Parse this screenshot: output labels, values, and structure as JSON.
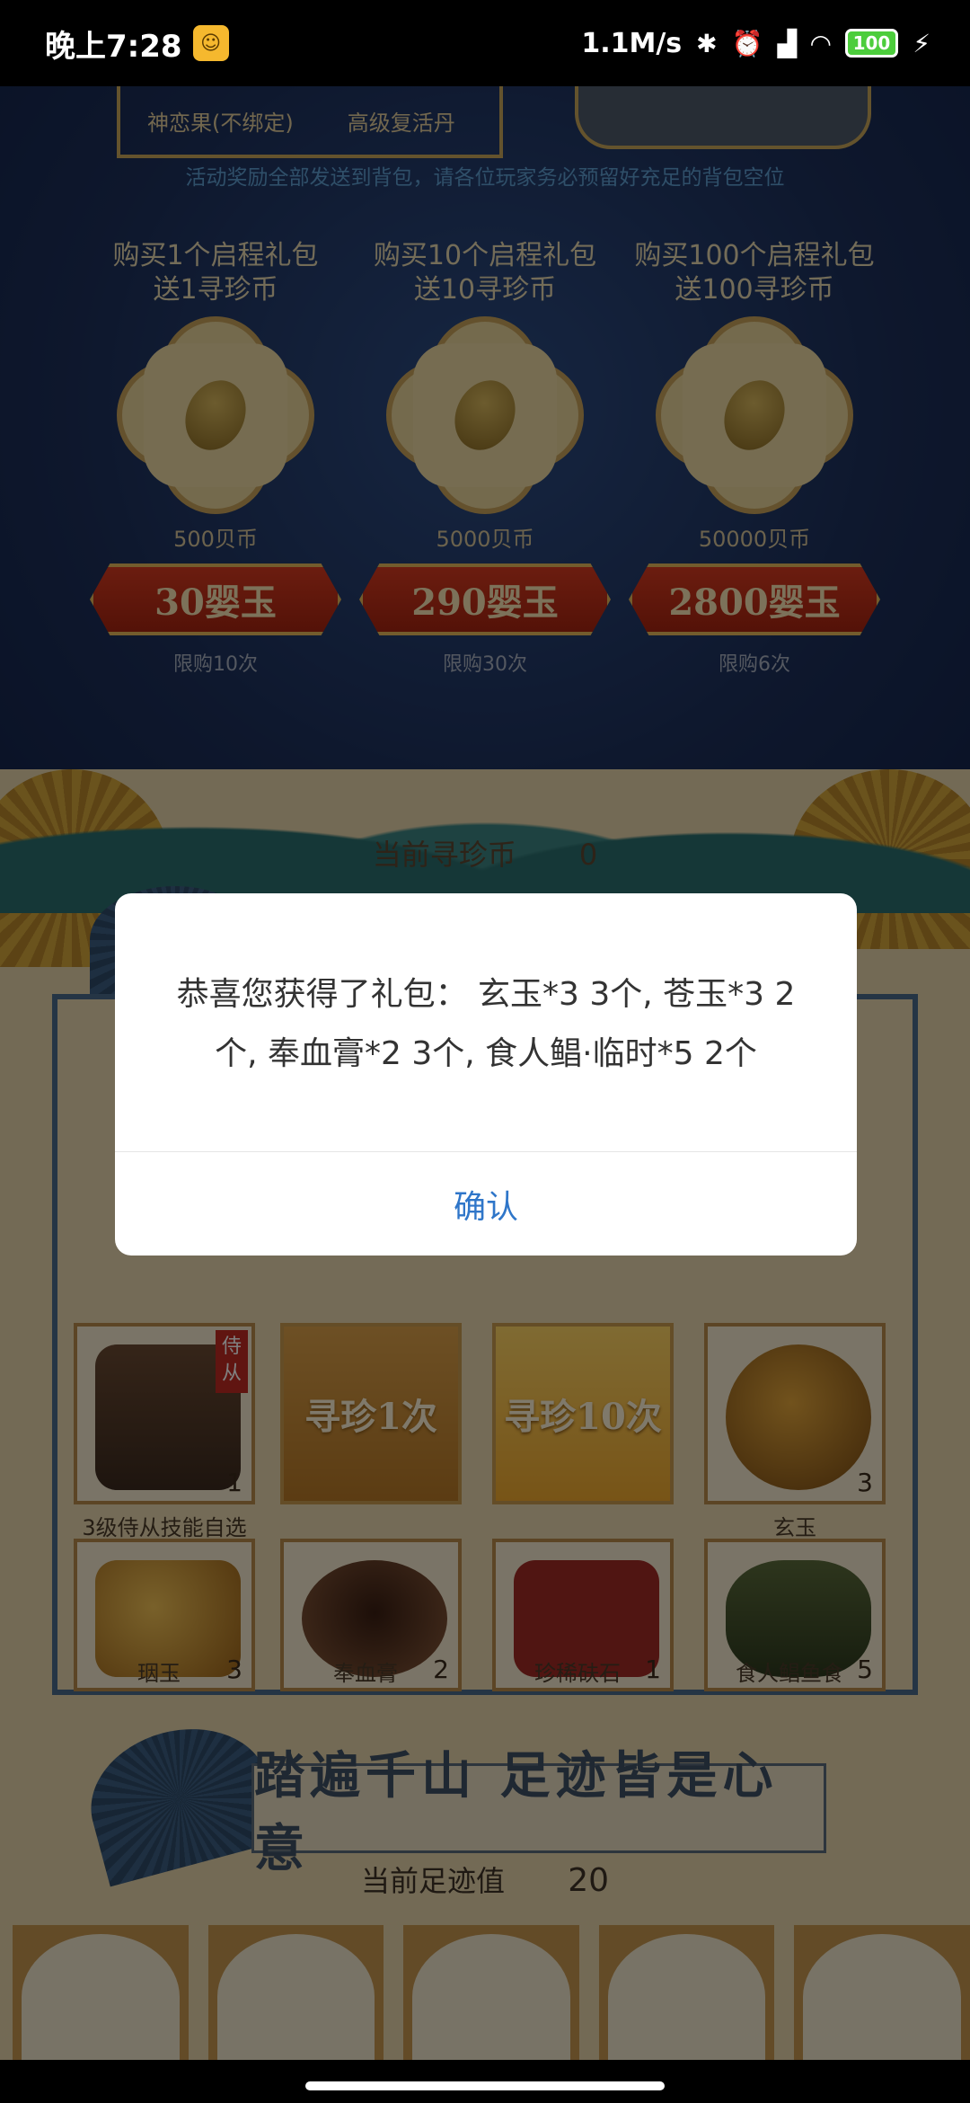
{
  "status_bar": {
    "time": "晚上7:28",
    "net_speed": "1.1M/s",
    "battery": "100"
  },
  "top": {
    "frame_left_texts": [
      "神恋果(不绑定)",
      "高级复活丹"
    ],
    "notice": "活动奖励全部发送到背包，请各位玩家务必预留好充足的背包空位",
    "offers": [
      {
        "title_line1": "购买1个启程礼包",
        "title_line2": "送1寻珍币",
        "coins": "500贝币",
        "price": "30婴玉",
        "limit": "限购10次"
      },
      {
        "title_line1": "购买10个启程礼包",
        "title_line2": "送10寻珍币",
        "coins": "5000贝币",
        "price": "290婴玉",
        "limit": "限购30次"
      },
      {
        "title_line1": "购买100个启程礼包",
        "title_line2": "送100寻珍币",
        "coins": "50000贝币",
        "price": "2800婴玉",
        "limit": "限购6次"
      }
    ]
  },
  "treasure": {
    "coin_label": "当前寻珍币",
    "coin_value": "0",
    "items": [
      {
        "label": "3级侍从技能自选",
        "count": "1",
        "tag": "侍从"
      },
      {
        "label": "玄玉",
        "count": "3"
      },
      {
        "label": "珚玉",
        "count": "3"
      },
      {
        "label": "奉血膏",
        "count": "2"
      },
      {
        "label": "珍稀砆石",
        "count": "1"
      },
      {
        "label": "食人鲳鱼食",
        "count": "5"
      }
    ],
    "btn_once": "寻珍1次",
    "btn_ten": "寻珍10次"
  },
  "footprint": {
    "title": "踏遍千山 足迹皆是心意",
    "value_label": "当前足迹值",
    "value": "20"
  },
  "dialog": {
    "message": "恭喜您获得了礼包： 玄玉*3 3个, 苍玉*3 2个, 奉血膏*2 3个, 食人鲳·临时*5 2个",
    "confirm": "确认"
  },
  "colors": {
    "dialog_confirm": "#2f76c9",
    "price_button": "#c22e16",
    "top_background": "#1f345f",
    "parchment": "#e6d4ab"
  }
}
